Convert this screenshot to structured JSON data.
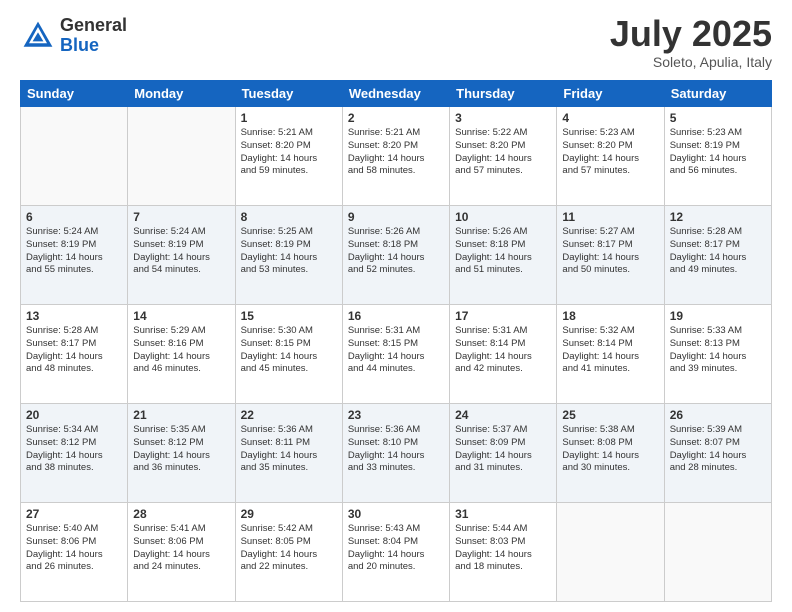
{
  "header": {
    "logo_general": "General",
    "logo_blue": "Blue",
    "title": "July 2025",
    "location": "Soleto, Apulia, Italy"
  },
  "days_of_week": [
    "Sunday",
    "Monday",
    "Tuesday",
    "Wednesday",
    "Thursday",
    "Friday",
    "Saturday"
  ],
  "weeks": [
    [
      {
        "day": "",
        "info": ""
      },
      {
        "day": "",
        "info": ""
      },
      {
        "day": "1",
        "info": "Sunrise: 5:21 AM\nSunset: 8:20 PM\nDaylight: 14 hours\nand 59 minutes."
      },
      {
        "day": "2",
        "info": "Sunrise: 5:21 AM\nSunset: 8:20 PM\nDaylight: 14 hours\nand 58 minutes."
      },
      {
        "day": "3",
        "info": "Sunrise: 5:22 AM\nSunset: 8:20 PM\nDaylight: 14 hours\nand 57 minutes."
      },
      {
        "day": "4",
        "info": "Sunrise: 5:23 AM\nSunset: 8:20 PM\nDaylight: 14 hours\nand 57 minutes."
      },
      {
        "day": "5",
        "info": "Sunrise: 5:23 AM\nSunset: 8:19 PM\nDaylight: 14 hours\nand 56 minutes."
      }
    ],
    [
      {
        "day": "6",
        "info": "Sunrise: 5:24 AM\nSunset: 8:19 PM\nDaylight: 14 hours\nand 55 minutes."
      },
      {
        "day": "7",
        "info": "Sunrise: 5:24 AM\nSunset: 8:19 PM\nDaylight: 14 hours\nand 54 minutes."
      },
      {
        "day": "8",
        "info": "Sunrise: 5:25 AM\nSunset: 8:19 PM\nDaylight: 14 hours\nand 53 minutes."
      },
      {
        "day": "9",
        "info": "Sunrise: 5:26 AM\nSunset: 8:18 PM\nDaylight: 14 hours\nand 52 minutes."
      },
      {
        "day": "10",
        "info": "Sunrise: 5:26 AM\nSunset: 8:18 PM\nDaylight: 14 hours\nand 51 minutes."
      },
      {
        "day": "11",
        "info": "Sunrise: 5:27 AM\nSunset: 8:17 PM\nDaylight: 14 hours\nand 50 minutes."
      },
      {
        "day": "12",
        "info": "Sunrise: 5:28 AM\nSunset: 8:17 PM\nDaylight: 14 hours\nand 49 minutes."
      }
    ],
    [
      {
        "day": "13",
        "info": "Sunrise: 5:28 AM\nSunset: 8:17 PM\nDaylight: 14 hours\nand 48 minutes."
      },
      {
        "day": "14",
        "info": "Sunrise: 5:29 AM\nSunset: 8:16 PM\nDaylight: 14 hours\nand 46 minutes."
      },
      {
        "day": "15",
        "info": "Sunrise: 5:30 AM\nSunset: 8:15 PM\nDaylight: 14 hours\nand 45 minutes."
      },
      {
        "day": "16",
        "info": "Sunrise: 5:31 AM\nSunset: 8:15 PM\nDaylight: 14 hours\nand 44 minutes."
      },
      {
        "day": "17",
        "info": "Sunrise: 5:31 AM\nSunset: 8:14 PM\nDaylight: 14 hours\nand 42 minutes."
      },
      {
        "day": "18",
        "info": "Sunrise: 5:32 AM\nSunset: 8:14 PM\nDaylight: 14 hours\nand 41 minutes."
      },
      {
        "day": "19",
        "info": "Sunrise: 5:33 AM\nSunset: 8:13 PM\nDaylight: 14 hours\nand 39 minutes."
      }
    ],
    [
      {
        "day": "20",
        "info": "Sunrise: 5:34 AM\nSunset: 8:12 PM\nDaylight: 14 hours\nand 38 minutes."
      },
      {
        "day": "21",
        "info": "Sunrise: 5:35 AM\nSunset: 8:12 PM\nDaylight: 14 hours\nand 36 minutes."
      },
      {
        "day": "22",
        "info": "Sunrise: 5:36 AM\nSunset: 8:11 PM\nDaylight: 14 hours\nand 35 minutes."
      },
      {
        "day": "23",
        "info": "Sunrise: 5:36 AM\nSunset: 8:10 PM\nDaylight: 14 hours\nand 33 minutes."
      },
      {
        "day": "24",
        "info": "Sunrise: 5:37 AM\nSunset: 8:09 PM\nDaylight: 14 hours\nand 31 minutes."
      },
      {
        "day": "25",
        "info": "Sunrise: 5:38 AM\nSunset: 8:08 PM\nDaylight: 14 hours\nand 30 minutes."
      },
      {
        "day": "26",
        "info": "Sunrise: 5:39 AM\nSunset: 8:07 PM\nDaylight: 14 hours\nand 28 minutes."
      }
    ],
    [
      {
        "day": "27",
        "info": "Sunrise: 5:40 AM\nSunset: 8:06 PM\nDaylight: 14 hours\nand 26 minutes."
      },
      {
        "day": "28",
        "info": "Sunrise: 5:41 AM\nSunset: 8:06 PM\nDaylight: 14 hours\nand 24 minutes."
      },
      {
        "day": "29",
        "info": "Sunrise: 5:42 AM\nSunset: 8:05 PM\nDaylight: 14 hours\nand 22 minutes."
      },
      {
        "day": "30",
        "info": "Sunrise: 5:43 AM\nSunset: 8:04 PM\nDaylight: 14 hours\nand 20 minutes."
      },
      {
        "day": "31",
        "info": "Sunrise: 5:44 AM\nSunset: 8:03 PM\nDaylight: 14 hours\nand 18 minutes."
      },
      {
        "day": "",
        "info": ""
      },
      {
        "day": "",
        "info": ""
      }
    ]
  ]
}
